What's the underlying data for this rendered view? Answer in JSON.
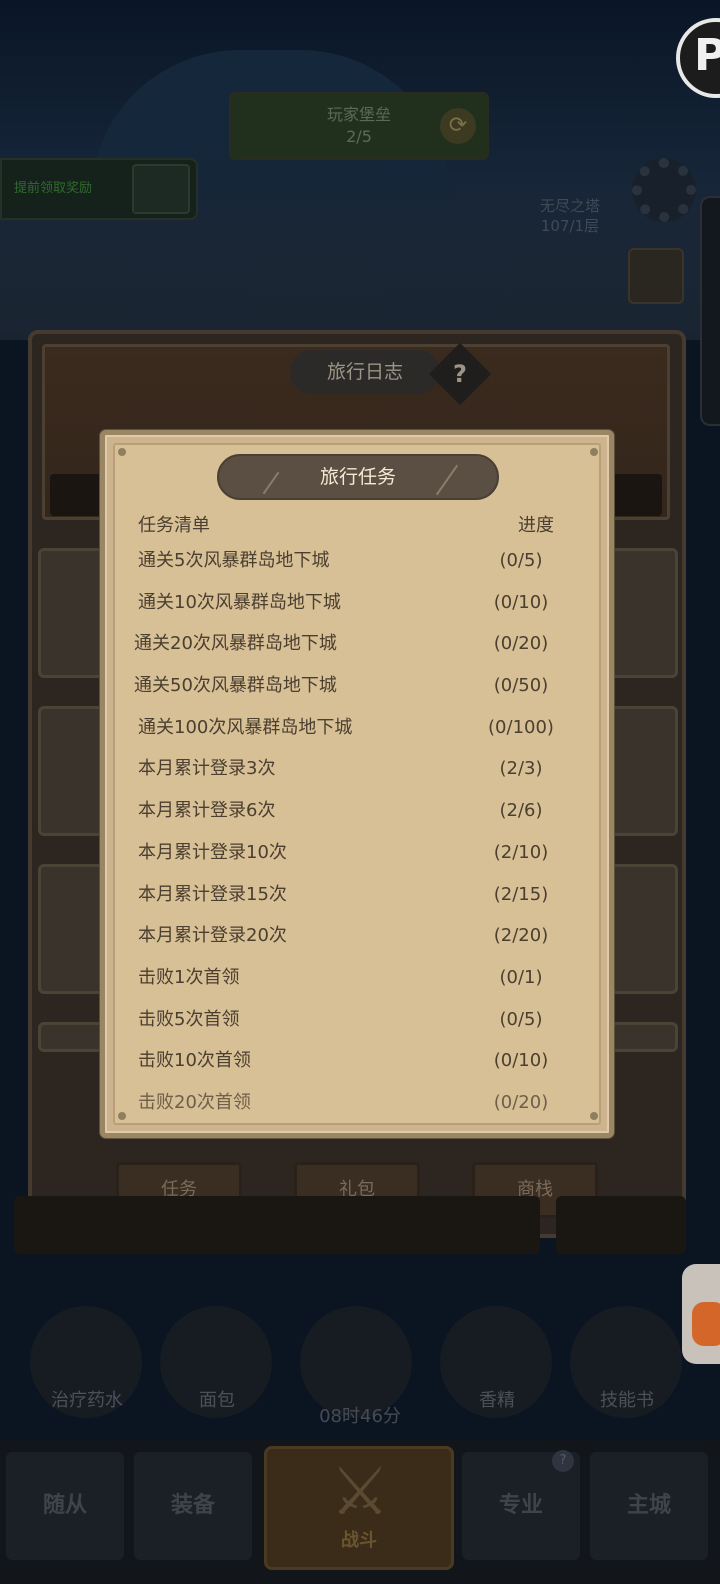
{
  "background": {
    "top_banner": {
      "line1": "玩家堡垒",
      "line2": "2/5"
    },
    "left_pill_text": "提前领取奖励",
    "right_label": {
      "line1": "无尽之塔",
      "line2": "107/1层"
    },
    "journal": {
      "title": "旅行日志",
      "help_glyph": "?",
      "tabs": [
        "任务",
        "礼包",
        "商栈"
      ]
    },
    "hud": {
      "items": [
        "治疗药水",
        "面包",
        "",
        "香精",
        "技能书"
      ],
      "timer": "08时46分",
      "nav": [
        "随从",
        "装备",
        "战斗",
        "专业",
        "主城"
      ]
    },
    "logo_glyph": "P"
  },
  "modal": {
    "title": "旅行任务",
    "col_task": "任务清单",
    "col_progress": "进度",
    "quests": [
      {
        "name": "通关5次风暴群岛地下城",
        "progress": "(0/5)"
      },
      {
        "name": "通关10次风暴群岛地下城",
        "progress": "(0/10)"
      },
      {
        "name": "通关20次风暴群岛地下城",
        "progress": "(0/20)"
      },
      {
        "name": "通关50次风暴群岛地下城",
        "progress": "(0/50)"
      },
      {
        "name": "通关100次风暴群岛地下城",
        "progress": "(0/100)"
      },
      {
        "name": "本月累计登录3次",
        "progress": "(2/3)"
      },
      {
        "name": "本月累计登录6次",
        "progress": "(2/6)"
      },
      {
        "name": "本月累计登录10次",
        "progress": "(2/10)"
      },
      {
        "name": "本月累计登录15次",
        "progress": "(2/15)"
      },
      {
        "name": "本月累计登录20次",
        "progress": "(2/20)"
      },
      {
        "name": "击败1次首领",
        "progress": "(0/1)"
      },
      {
        "name": "击败5次首领",
        "progress": "(0/5)"
      },
      {
        "name": "击败10次首领",
        "progress": "(0/10)"
      },
      {
        "name": "击败20次首领",
        "progress": "(0/20)"
      }
    ]
  },
  "colors": {
    "parchment": "#d7bf96",
    "title_pill": "#5b4e42",
    "text": "#4b3f30"
  }
}
